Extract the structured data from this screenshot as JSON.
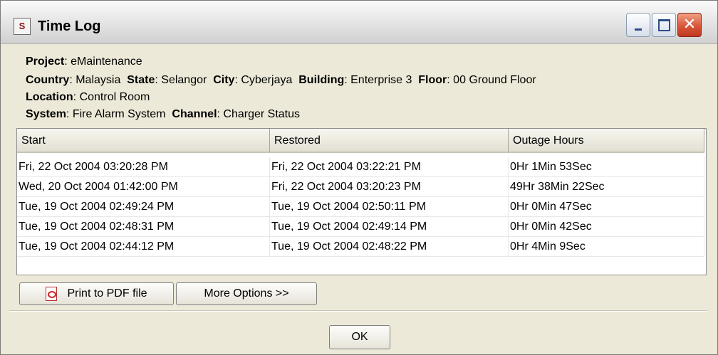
{
  "window": {
    "title": "Time Log",
    "icon": "app-logo-icon",
    "controls": {
      "minimize": "minimize-icon",
      "maximize": "maximize-icon",
      "close": "close-icon"
    }
  },
  "info": {
    "project_label": "Project",
    "project_value": "eMaintenance",
    "country_label": "Country",
    "country_value": "Malaysia",
    "state_label": "State",
    "state_value": "Selangor",
    "city_label": "City",
    "city_value": "Cyberjaya",
    "building_label": "Building",
    "building_value": "Enterprise 3",
    "floor_label": "Floor",
    "floor_value": "00 Ground Floor",
    "location_label": "Location",
    "location_value": "Control Room",
    "system_label": "System",
    "system_value": "Fire Alarm System",
    "channel_label": "Channel",
    "channel_value": "Charger Status"
  },
  "table": {
    "columns": [
      "Start",
      "Restored",
      "Outage Hours"
    ],
    "rows": [
      [
        "Fri, 22 Oct 2004 03:20:28 PM",
        "Fri, 22 Oct 2004 03:22:21 PM",
        "0Hr 1Min 53Sec"
      ],
      [
        "Wed, 20 Oct 2004 01:42:00 PM",
        "Fri, 22 Oct 2004 03:20:23 PM",
        "49Hr 38Min 22Sec"
      ],
      [
        "Tue, 19 Oct 2004 02:49:24 PM",
        "Tue, 19 Oct 2004 02:50:11 PM",
        "0Hr 0Min 47Sec"
      ],
      [
        "Tue, 19 Oct 2004 02:48:31 PM",
        "Tue, 19 Oct 2004 02:49:14 PM",
        "0Hr 0Min 42Sec"
      ],
      [
        "Tue, 19 Oct 2004 02:44:12 PM",
        "Tue, 19 Oct 2004 02:48:22 PM",
        "0Hr 4Min 9Sec"
      ]
    ]
  },
  "buttons": {
    "print_pdf": "Print to PDF file",
    "more_options": "More Options >>",
    "ok": "OK"
  }
}
